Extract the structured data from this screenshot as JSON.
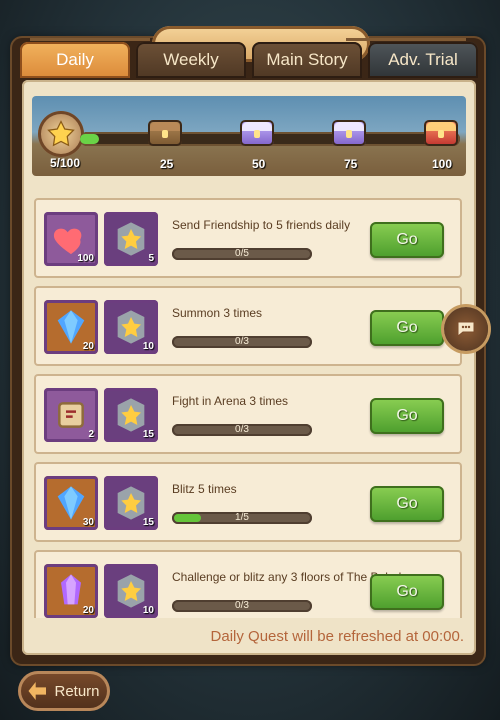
{
  "tabs": [
    {
      "label": "Daily",
      "active": true
    },
    {
      "label": "Weekly",
      "active": false
    },
    {
      "label": "Main Story",
      "active": false
    },
    {
      "label": "Adv. Trial",
      "active": false
    }
  ],
  "daily_progress": {
    "value_text": "5/100",
    "current": 5,
    "max": 100,
    "milestones": [
      "25",
      "50",
      "75",
      "100"
    ]
  },
  "quests": [
    {
      "title": "Send Friendship to 5 friends daily",
      "progress": "0/5",
      "fill": 0.0,
      "button": "Go",
      "rewards": [
        {
          "icon": "heart-icon",
          "count": "100"
        },
        {
          "icon": "star-badge-icon",
          "count": "5"
        }
      ]
    },
    {
      "title": "Summon 3 times",
      "progress": "0/3",
      "fill": 0.0,
      "button": "Go",
      "rewards": [
        {
          "icon": "diamond-icon",
          "count": "20"
        },
        {
          "icon": "star-badge-icon",
          "count": "10"
        }
      ]
    },
    {
      "title": "Fight in Arena 3 times",
      "progress": "0/3",
      "fill": 0.0,
      "button": "Go",
      "rewards": [
        {
          "icon": "scroll-map-icon",
          "count": "2"
        },
        {
          "icon": "star-badge-icon",
          "count": "15"
        }
      ]
    },
    {
      "title": "Blitz 5 times",
      "progress": "1/5",
      "fill": 0.2,
      "button": "Go",
      "rewards": [
        {
          "icon": "diamond-icon",
          "count": "30"
        },
        {
          "icon": "star-badge-icon",
          "count": "15"
        }
      ]
    },
    {
      "title": "Challenge or blitz any 3 floors of The Babel",
      "progress": "0/3",
      "fill": 0.0,
      "button": "Go",
      "rewards": [
        {
          "icon": "purple-crystal-icon",
          "count": "20"
        },
        {
          "icon": "star-badge-icon",
          "count": "10"
        }
      ]
    }
  ],
  "footer": {
    "refresh_text": "Daily Quest will be refreshed at 00:00."
  },
  "bottom": {
    "return_label": "Return"
  },
  "colors": {
    "go_button": "#61b43c",
    "active_tab": "#e89a45",
    "progress_fill": "#65c53a"
  }
}
